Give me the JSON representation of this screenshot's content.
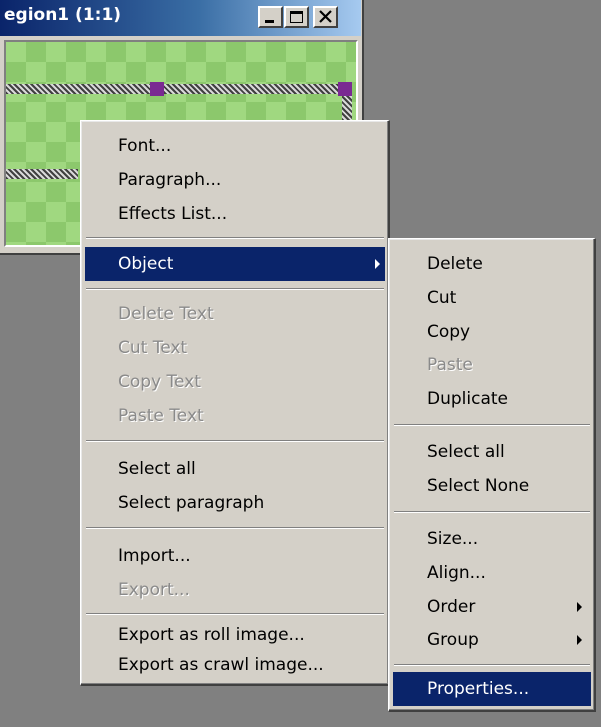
{
  "window": {
    "title": "egion1  (1:1)"
  },
  "context_menu": {
    "items": [
      {
        "label": "Font...",
        "enabled": true
      },
      {
        "label": "Paragraph...",
        "enabled": true
      },
      {
        "label": "Effects List...",
        "enabled": true
      },
      {
        "label": "Object",
        "enabled": true,
        "highlighted": true,
        "has_submenu": true
      },
      {
        "label": "Delete Text",
        "enabled": false
      },
      {
        "label": "Cut Text",
        "enabled": false
      },
      {
        "label": "Copy Text",
        "enabled": false
      },
      {
        "label": "Paste Text",
        "enabled": false
      },
      {
        "label": "Select all",
        "enabled": true
      },
      {
        "label": "Select paragraph",
        "enabled": true
      },
      {
        "label": "Import...",
        "enabled": true
      },
      {
        "label": "Export...",
        "enabled": false
      },
      {
        "label": "Export as roll image...",
        "enabled": true
      },
      {
        "label": "Export as crawl image...",
        "enabled": true
      }
    ]
  },
  "object_submenu": {
    "items": [
      {
        "label": "Delete",
        "enabled": true
      },
      {
        "label": "Cut",
        "enabled": true
      },
      {
        "label": "Copy",
        "enabled": true
      },
      {
        "label": "Paste",
        "enabled": false
      },
      {
        "label": "Duplicate",
        "enabled": true
      },
      {
        "label": "Select all",
        "enabled": true
      },
      {
        "label": "Select None",
        "enabled": true
      },
      {
        "label": "Size...",
        "enabled": true
      },
      {
        "label": "Align...",
        "enabled": true
      },
      {
        "label": "Order",
        "enabled": true,
        "has_submenu": true
      },
      {
        "label": "Group",
        "enabled": true,
        "has_submenu": true
      },
      {
        "label": "Properties...",
        "enabled": true,
        "highlighted": true
      }
    ]
  },
  "colors": {
    "menu_highlight": "#0a246a",
    "menu_face": "#d4d0c8",
    "desktop": "#808080",
    "selection_handle": "#7a2a92"
  },
  "icons": [
    "minimize-icon",
    "maximize-icon",
    "close-icon",
    "submenu-arrow-icon"
  ]
}
